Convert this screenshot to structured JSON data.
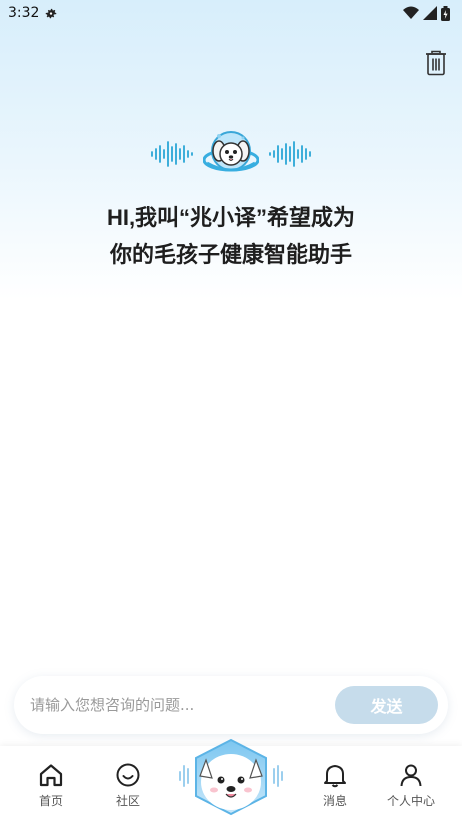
{
  "status_bar": {
    "time": "3:32",
    "icons": [
      "settings-icon",
      "wifi-icon",
      "signal-icon",
      "battery-icon"
    ]
  },
  "header": {
    "trash_icon": "trash-icon"
  },
  "hero": {
    "line1": "HI,我叫“兆小译”希望成为",
    "line2": "你的毛孩子健康智能助手"
  },
  "input": {
    "placeholder": "请输入您想咨询的问题...",
    "value": "",
    "send_label": "发送"
  },
  "nav": {
    "items": [
      {
        "label": "首页",
        "icon": "home-icon"
      },
      {
        "label": "社区",
        "icon": "smile-icon"
      },
      {
        "label": "",
        "icon": "mascot-assistant-icon"
      },
      {
        "label": "消息",
        "icon": "bell-icon"
      },
      {
        "label": "个人中心",
        "icon": "user-icon"
      }
    ]
  },
  "colors": {
    "accent": "#1aa8d8",
    "send_disabled": "#c6dceb",
    "bg_top": "#d7eefb"
  }
}
